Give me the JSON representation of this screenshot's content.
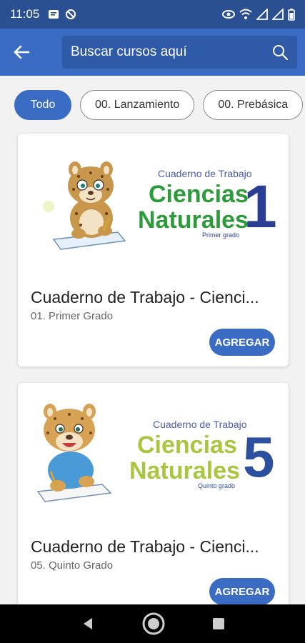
{
  "status": {
    "time": "11:05"
  },
  "search": {
    "placeholder": "Buscar cursos aquí"
  },
  "filters": [
    {
      "label": "Todo",
      "active": true
    },
    {
      "label": "00. Lanzamiento",
      "active": false
    },
    {
      "label": "00. Prebásica",
      "active": false
    }
  ],
  "courses": [
    {
      "cover_header": "Cuaderno de Trabajo",
      "cover_line1": "Ciencias",
      "cover_line2": "Naturales",
      "cover_number": "1",
      "cover_grade": "Primer grado",
      "title": "Cuaderno de Trabajo - Cienci...",
      "subtitle": "01. Primer Grado",
      "button": "AGREGAR"
    },
    {
      "cover_header": "Cuaderno de Trabajo",
      "cover_line1": "Ciencias",
      "cover_line2": "Naturales",
      "cover_number": "5",
      "cover_grade": "Quinto grado",
      "title": "Cuaderno de Trabajo - Cienci...",
      "subtitle": "05. Quinto Grado",
      "button": "AGREGAR"
    }
  ],
  "colors": {
    "status_bar": "#2a5092",
    "app_bar": "#3b6cc4",
    "accent": "#3b6cc4",
    "cover1_green": "#2e9b3a",
    "cover1_number": "#2c3e94",
    "cover5_green": "#a8c640",
    "cover5_number": "#2c4f9e"
  }
}
